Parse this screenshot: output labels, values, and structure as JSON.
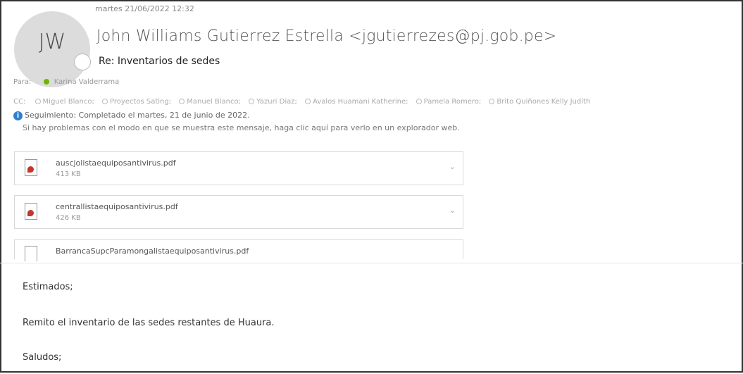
{
  "email": {
    "date": "martes 21/06/2022 12:32",
    "avatar_initials": "JW",
    "sender": "John Williams Gutierrez Estrella <jgutierrezes@pj.gob.pe>",
    "subject": "Re: Inventarios de sedes",
    "to_label": "Para:",
    "to": "Karina Valderrama",
    "cc_label": "CC:",
    "cc": [
      "Miguel Blanco;",
      "Proyectos Sating;",
      "Manuel Blanco;",
      "Yazuri Diaz;",
      "Avalos Huamani Katherine;",
      "Pamela Romero;",
      "Brito Quiñones Kelly Judith"
    ],
    "tracking": "Seguimiento: Completado el martes, 21 de junio de 2022.",
    "notice": "Si hay problemas con el modo en que se muestra este mensaje, haga clic aquí para verlo en un explorador web.",
    "attachments": [
      {
        "name": "auscjolistaequiposantivirus.pdf",
        "size": "413 KB"
      },
      {
        "name": "centrallistaequiposantivirus.pdf",
        "size": "426 KB"
      },
      {
        "name": "BarrancaSupcParamongalistaequiposantivirus.pdf",
        "size": ""
      }
    ],
    "body": {
      "greeting": "Estimados;",
      "message": "Remito el inventario de las sedes restantes de Huaura.",
      "closing": "Saludos;"
    }
  },
  "colors": {
    "presence_green": "#6bb700",
    "info_blue": "#2f7fd1",
    "pdf_red": "#c8342b"
  }
}
